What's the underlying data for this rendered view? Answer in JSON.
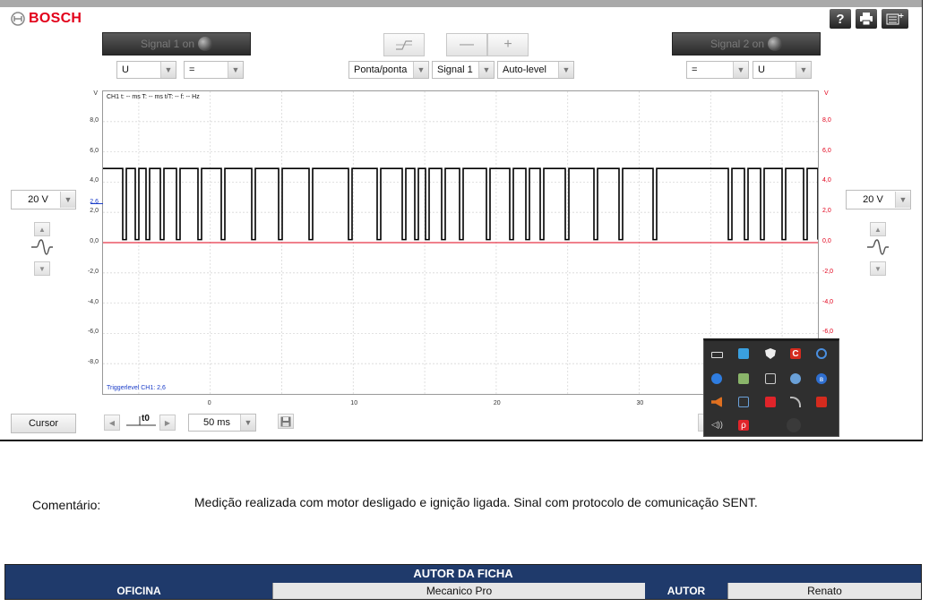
{
  "header": {
    "brand": "BOSCH",
    "help_icon": "help-icon",
    "print_icon": "printer-icon",
    "menu_icon": "menu-icon"
  },
  "signal1": {
    "label": "Signal 1 on"
  },
  "signal2": {
    "label": "Signal 2 on"
  },
  "trigger_buttons": {
    "edge_icon": "trigger-edge-icon",
    "minus": "—",
    "plus": "+"
  },
  "dropdowns": {
    "ch1_unit": "U",
    "ch1_coupling": "=",
    "measure_mode": "Ponta/ponta",
    "source": "Signal 1",
    "level_mode": "Auto-level",
    "ch2_coupling": "=",
    "ch2_unit": "U"
  },
  "left_range": "20 V",
  "right_range": "20 V",
  "plot": {
    "axis_unit_left": "V",
    "axis_unit_right": "V",
    "info": "CH1 t: -- ms  T: -- ms  t/T: --  f: -- Hz",
    "trigger_level_value": "2,6",
    "trigger_level_text": "Triggerlevel CH1: 2,6",
    "y_ticks": [
      "8,0",
      "6,0",
      "4,0",
      "2,0",
      "0,0",
      "-2,0",
      "-4,0",
      "-6,0",
      "-8,0"
    ],
    "y_ticks_right": [
      "8,0",
      "6,0",
      "4,0",
      "2,0",
      "0,0",
      "-2,0",
      "-4,0",
      "-6,0"
    ],
    "x_ticks": [
      "0",
      "10",
      "20",
      "30"
    ]
  },
  "chart_data": {
    "type": "line",
    "title": "",
    "xlabel": "",
    "ylabel": "V",
    "xlim": [
      -7.5,
      42.5
    ],
    "ylim": [
      -10,
      10
    ],
    "grid": true,
    "series": [
      {
        "values_high": 4.9,
        "values_low": 0.2,
        "pattern": "SENT digital pulse train"
      }
    ],
    "trigger_level": 2.6,
    "reference_line": 0.0,
    "colors": {
      "trace": "#000000",
      "zero_line": "#e2001a",
      "trigger_marker": "#1a3cc8"
    }
  },
  "bottom": {
    "cursor_label": "Cursor",
    "t0_label": "t0",
    "timebase": "50 ms",
    "save_icon": "save-icon"
  },
  "comment": {
    "label": "Comentário:",
    "text": "Medição realizada com motor desligado e ignição ligada. Sinal com protocolo de comunicação SENT."
  },
  "footer": {
    "title": "AUTOR DA FICHA",
    "oficina_label": "OFICINA",
    "oficina_value": "Mecanico Pro",
    "autor_label": "AUTOR",
    "autor_value": "Renato"
  }
}
